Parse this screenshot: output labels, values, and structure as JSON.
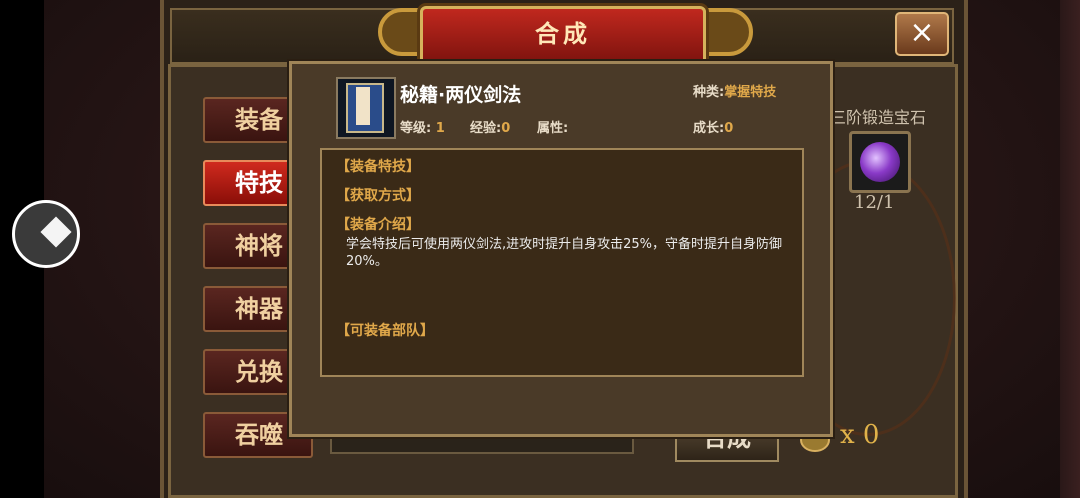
{
  "window": {
    "title": "合成",
    "close_icon": "×"
  },
  "tabs": [
    "装备",
    "特技",
    "神将",
    "神器",
    "兑换",
    "吞噬"
  ],
  "active_tab": "特技",
  "gem": {
    "name": "三阶锻造宝石",
    "count": "12/1"
  },
  "coins": {
    "count": "x 0"
  },
  "synthesize_button": "合成",
  "tooltip": {
    "item_name": "秘籍·两仪剑法",
    "category_label": "种类:",
    "category_value": "掌握特技",
    "level_label": "等级:",
    "level_value": "1",
    "exp_label": "经验:",
    "exp_value": "0",
    "attr_label": "属性:",
    "growth_label": "成长:",
    "growth_value": "0",
    "sections": {
      "equip_skill": "【装备特技】",
      "obtain": "【获取方式】",
      "intro": "【装备介绍】",
      "intro_text": "学会特技后可使用两仪剑法,进攻时提升自身攻击25%，守备时提升自身防御20%。",
      "troops": "【可装备部队】"
    }
  },
  "colors": {
    "accent_gold": "#e0a84a",
    "active_tab_red": "#c62418"
  }
}
